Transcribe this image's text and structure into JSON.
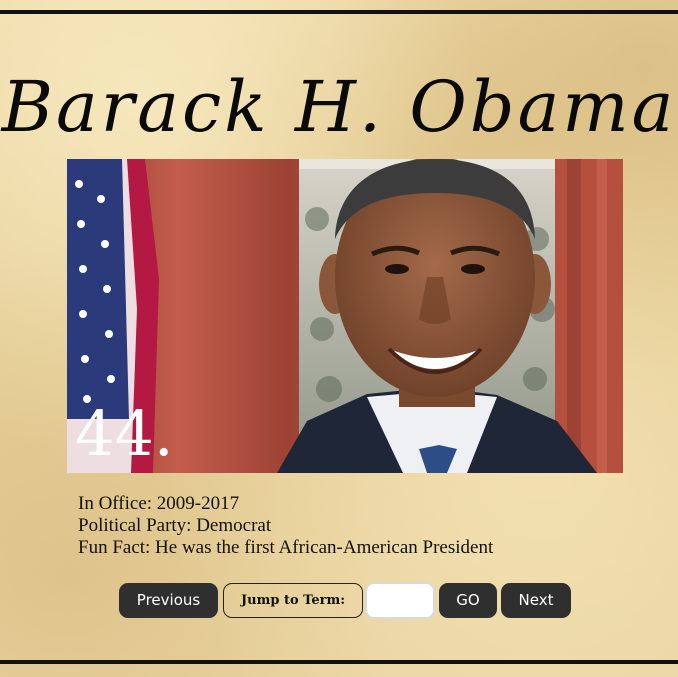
{
  "president": {
    "name": "Barack H. Obama",
    "term_number": "44."
  },
  "facts": {
    "in_office": "In Office: 2009-2017",
    "party": "Political Party: Democrat",
    "fun_fact": "Fun Fact: He was the first African-American President"
  },
  "nav": {
    "previous_label": "Previous",
    "jump_label": "Jump to Term:",
    "jump_value": "",
    "go_label": "GO",
    "next_label": "Next"
  },
  "colors": {
    "background": "#e9d49f",
    "rule": "#111111",
    "button": "#2f2f2f",
    "button_text": "#ffffff"
  }
}
